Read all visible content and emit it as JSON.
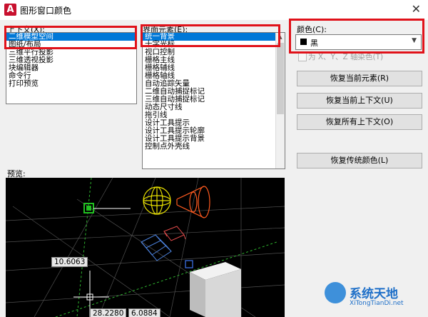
{
  "window": {
    "title": "图形窗口颜色",
    "close_glyph": "✕",
    "app_glyph": "A"
  },
  "context": {
    "label": "上下文(X):",
    "items": [
      "二维模型空间",
      "图纸/布局",
      "三维平行投影",
      "三维透视投影",
      "块编辑器",
      "命令行",
      "打印预览"
    ],
    "selected_index": 0
  },
  "interface": {
    "label": "界面元素(E):",
    "items": [
      "统一背景",
      "十字光标",
      "视口控制",
      "栅格主线",
      "栅格辅线",
      "栅格轴线",
      "自动追踪矢量",
      "二维自动捕捉标记",
      "三维自动捕捉标记",
      "动态尺寸线",
      "拖引线",
      "设计工具提示",
      "设计工具提示轮廓",
      "设计工具提示背景",
      "控制点外壳线"
    ],
    "selected_index": 0
  },
  "color": {
    "label": "颜色(C):",
    "value": "黑",
    "swatch": "#000000"
  },
  "tint": {
    "label": "为 X、Y、Z 轴染色(T)",
    "checked": false
  },
  "buttons": {
    "restore_element": "恢复当前元素(R)",
    "restore_context": "恢复当前上下文(U)",
    "restore_all": "恢复所有上下文(O)",
    "restore_classic": "恢复传统颜色(L)"
  },
  "preview": {
    "label": "预览:",
    "dim1": "10.6063",
    "dim2": "28.2280",
    "dim3": "6.0884"
  },
  "watermark": {
    "text": "系统天地",
    "url": "XiTongTianDi.net"
  }
}
